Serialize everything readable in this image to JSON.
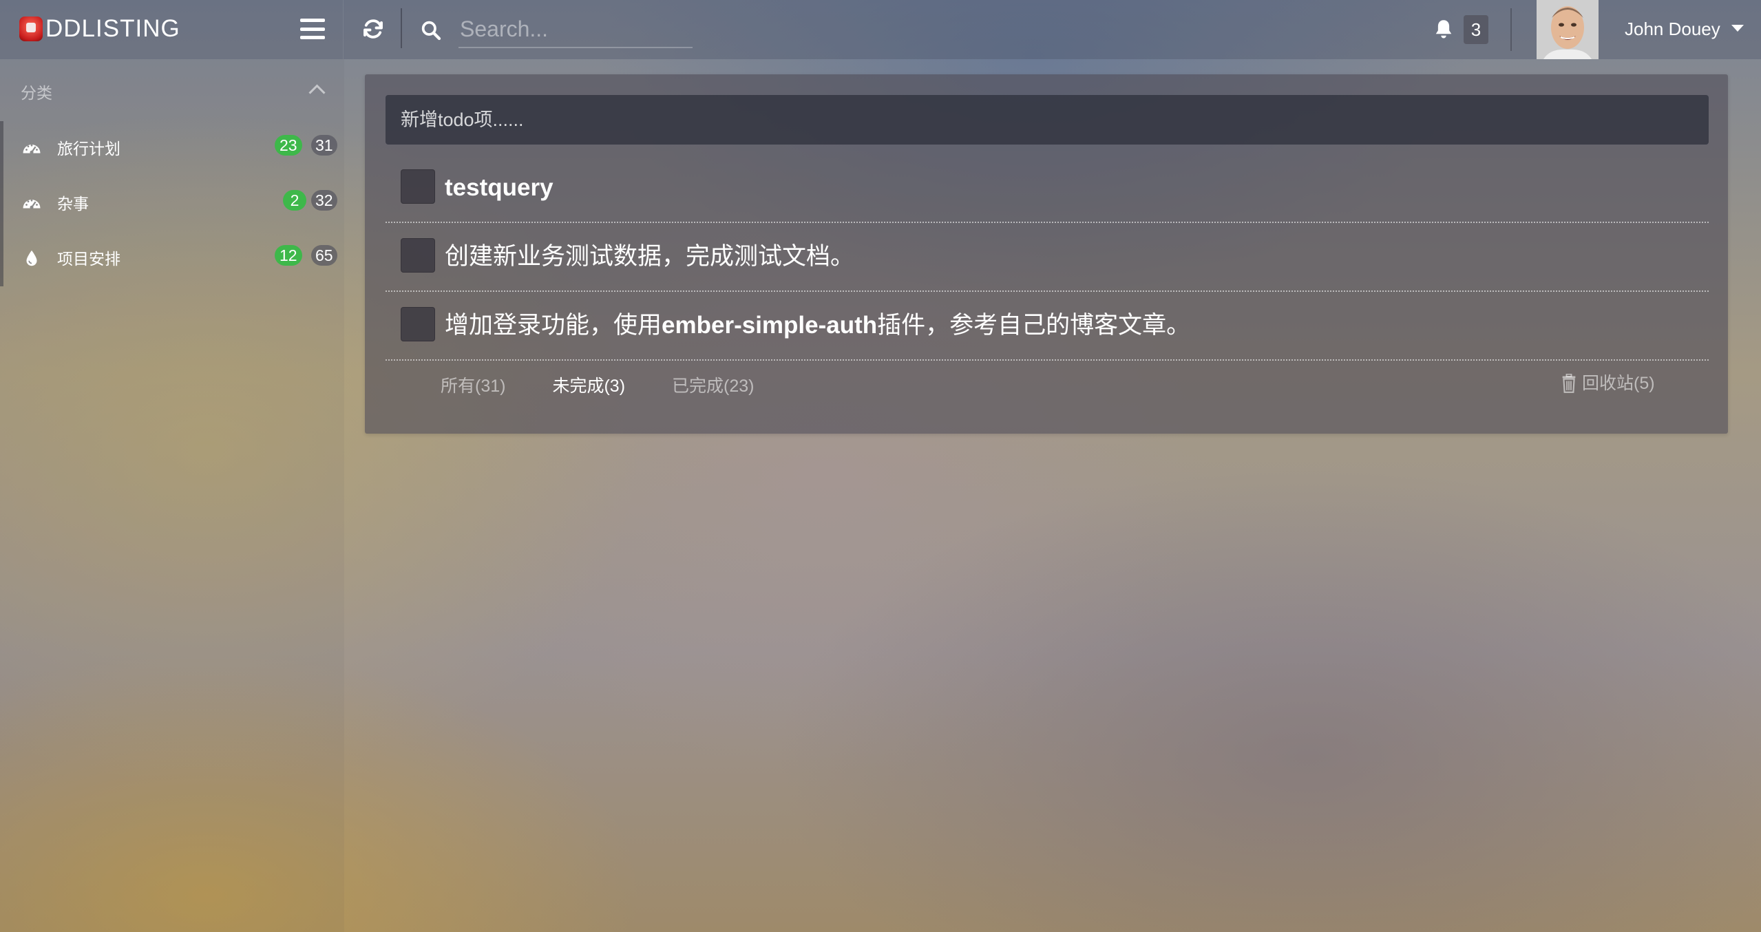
{
  "app": {
    "logo_text": "DDLISTING"
  },
  "search": {
    "placeholder": "Search..."
  },
  "notifications": {
    "count": "3"
  },
  "user": {
    "name": "John Douey"
  },
  "sidebar": {
    "header": "分类",
    "categories": [
      {
        "label": "旅行计划",
        "done": "23",
        "total": "31",
        "icon": "dashboard-icon"
      },
      {
        "label": "杂事",
        "done": "2",
        "total": "32",
        "icon": "dashboard-icon"
      },
      {
        "label": "项目安排",
        "done": "12",
        "total": "65",
        "icon": "tint-drop-icon"
      }
    ]
  },
  "main": {
    "new_todo_placeholder": "新增todo项......",
    "todos": [
      {
        "text": "testquery"
      },
      {
        "text": "创建新业务测试数据，完成测试文档。"
      },
      {
        "text_before": "增加登录功能，使用",
        "text_bold": "ember-simple-auth",
        "text_after": "插件，参考自己的博客文章。"
      }
    ],
    "filters": {
      "all": "所有(31)",
      "active": "未完成(3)",
      "completed": "已完成(23)"
    },
    "trash_label": "回收站(5)"
  },
  "colors": {
    "done_badge": "#3eb84a",
    "panel_bg": "rgba(80,78,88,0.62)",
    "text": "#ffffff"
  }
}
